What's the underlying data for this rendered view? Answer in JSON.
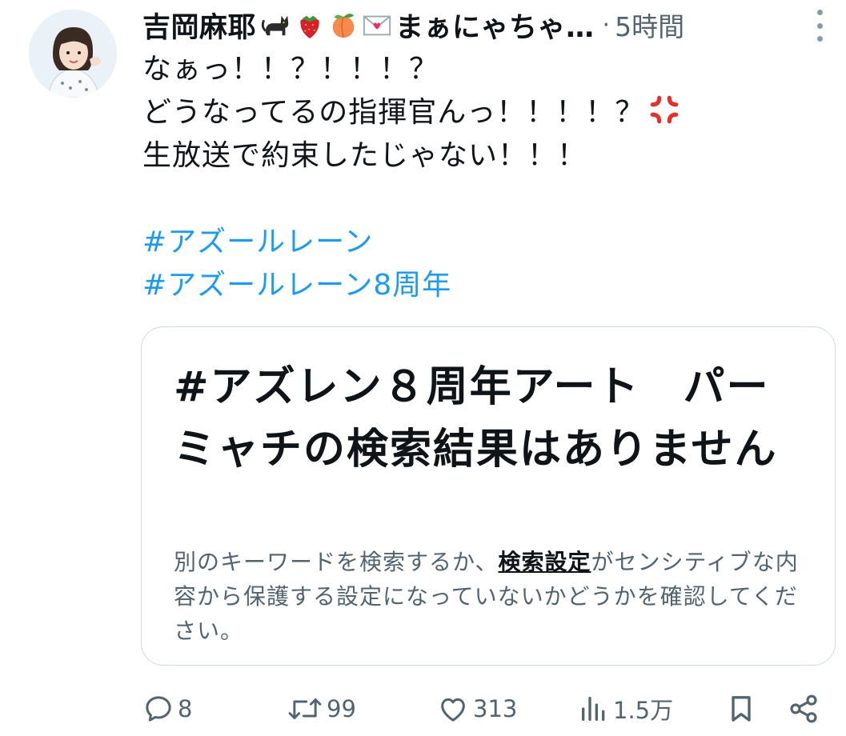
{
  "author": {
    "name": "吉岡麻耶",
    "name_suffix": "まぁにゃちゃ…",
    "emojis": [
      "black-cat-emoji",
      "strawberry-emoji",
      "peach-emoji",
      "love-letter-emoji"
    ],
    "separator": "·",
    "timestamp": "5時間"
  },
  "tweet": {
    "lines": [
      "なぁっ！！？！！！？",
      "どうなってるの指揮官んっ！！！！？",
      "生放送で約束したじゃない！！！"
    ],
    "hashtags": [
      "#アズールレーン",
      "#アズールレーン8周年"
    ]
  },
  "card": {
    "title": "#アズレン８周年アート　パーミャチの検索結果はありません",
    "desc_before": "別のキーワードを検索するか、",
    "desc_link": "検索設定",
    "desc_after": "がセンシティブな内容から保護する設定になっていないかどうかを確認してください。"
  },
  "actions": {
    "reply_count": "8",
    "retweet_count": "99",
    "like_count": "313",
    "views_count": "1.5万"
  },
  "colors": {
    "hashtag": "#1d9bf0",
    "muted": "#536471",
    "text": "#0f1419",
    "border": "#cfd9de"
  }
}
